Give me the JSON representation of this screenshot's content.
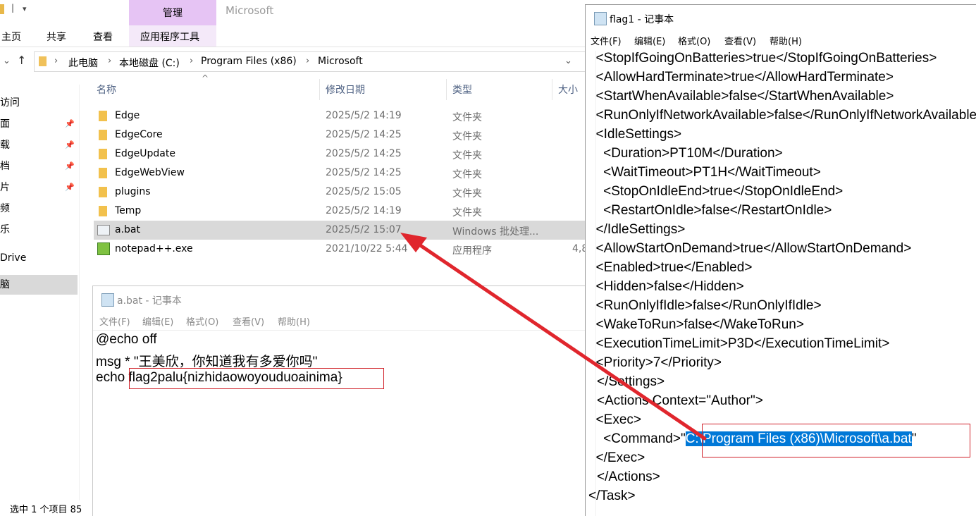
{
  "explorer": {
    "manage_tab": "管理",
    "window_title": "Microsoft",
    "tabs": [
      "主页",
      "共享",
      "查看",
      "应用程序工具"
    ],
    "breadcrumb": [
      "此电脑",
      "本地磁盘 (C:)",
      "Program Files (x86)",
      "Microsoft"
    ],
    "nav_items": [
      "访问",
      "面",
      "载",
      "档",
      "片",
      "频",
      "乐",
      "Drive",
      "脑"
    ],
    "columns": {
      "name": "名称",
      "date": "修改日期",
      "type": "类型",
      "size": "大小"
    },
    "files": [
      {
        "name": "Edge",
        "date": "2025/5/2 14:19",
        "type": "文件夹",
        "size": "",
        "icon": "folder-icon"
      },
      {
        "name": "EdgeCore",
        "date": "2025/5/2 14:25",
        "type": "文件夹",
        "size": "",
        "icon": "folder-icon"
      },
      {
        "name": "EdgeUpdate",
        "date": "2025/5/2 14:25",
        "type": "文件夹",
        "size": "",
        "icon": "folder-icon"
      },
      {
        "name": "EdgeWebView",
        "date": "2025/5/2 14:25",
        "type": "文件夹",
        "size": "",
        "icon": "folder-icon"
      },
      {
        "name": "plugins",
        "date": "2025/5/2 15:05",
        "type": "文件夹",
        "size": "",
        "icon": "folder-icon"
      },
      {
        "name": "Temp",
        "date": "2025/5/2 14:19",
        "type": "文件夹",
        "size": "",
        "icon": "folder-icon"
      },
      {
        "name": "a.bat",
        "date": "2025/5/2 15:07",
        "type": "Windows 批处理...",
        "size": "",
        "icon": "batch-file-icon"
      },
      {
        "name": "notepad++.exe",
        "date": "2021/10/22 5:44",
        "type": "应用程序",
        "size": "4,8",
        "icon": "notepadpp-icon"
      }
    ],
    "status": "选中 1 个项目  85"
  },
  "notepad_bat": {
    "title": "a.bat - 记事本",
    "menu": [
      "文件(F)",
      "编辑(E)",
      "格式(O)",
      "查看(V)",
      "帮助(H)"
    ],
    "lines": {
      "line1": "@echo off",
      "line2": "msg * \"王美欣，你知道我有多爱你吗\"",
      "line3_cmd": "echo ",
      "line3_flag": "flag2palu{nizhidaowoyouduoainima}"
    }
  },
  "notepad_xml": {
    "title": "flag1 - 记事本",
    "menu": [
      "文件(F)",
      "编辑(E)",
      "格式(O)",
      "查看(V)",
      "帮助(H)"
    ],
    "lines": [
      "  <StopIfGoingOnBatteries>true</StopIfGoingOnBatteries>",
      "  <AllowHardTerminate>true</AllowHardTerminate>",
      "  <StartWhenAvailable>false</StartWhenAvailable>",
      "  <RunOnlyIfNetworkAvailable>false</RunOnlyIfNetworkAvailable>",
      "  <IdleSettings>",
      "    <Duration>PT10M</Duration>",
      "    <WaitTimeout>PT1H</WaitTimeout>",
      "    <StopOnIdleEnd>true</StopOnIdleEnd>",
      "    <RestartOnIdle>false</RestartOnIdle>",
      "  </IdleSettings>",
      "  <AllowStartOnDemand>true</AllowStartOnDemand>",
      "  <Enabled>true</Enabled>",
      "  <Hidden>false</Hidden>",
      "  <RunOnlyIfIdle>false</RunOnlyIfIdle>",
      "  <WakeToRun>false</WakeToRun>",
      "  <ExecutionTimeLimit>P3D</ExecutionTimeLimit>",
      "  <Priority>7</Priority>",
      "</Settings>",
      "<Actions Context=\"Author\">",
      "  <Exec>"
    ],
    "command_prefix": "    <Command>\"",
    "command_path": "C:\\Program Files (x86)\\Microsoft\\a.bat",
    "command_suffix": "\"",
    "tail_lines": [
      "  </Exec>",
      "</Actions>",
      "</Task>"
    ]
  },
  "colors": {
    "selection": "#0078d7",
    "annotation_red": "#e0262d",
    "manage_tab": "#e6c4f4"
  }
}
